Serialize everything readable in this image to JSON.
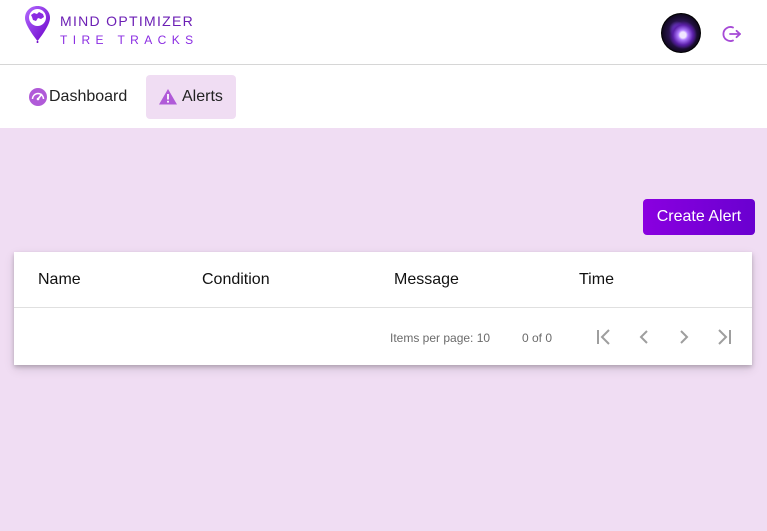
{
  "brand": {
    "line1": "MIND OPTIMIZER",
    "line2": "TIRE TRACKS",
    "color_primary": "#8a2be2"
  },
  "header": {
    "avatar_icon": "avatar-icon",
    "logout_icon": "logout-icon"
  },
  "nav": {
    "items": [
      {
        "label": "Dashboard",
        "icon": "speedometer-icon",
        "active": false
      },
      {
        "label": "Alerts",
        "icon": "warning-icon",
        "active": true
      }
    ]
  },
  "main": {
    "create_button_label": "Create Alert",
    "table": {
      "columns": [
        "Name",
        "Condition",
        "Message",
        "Time"
      ],
      "rows": []
    },
    "paginator": {
      "items_per_page_label": "Items per page:",
      "items_per_page_value": "10",
      "range_label": "0 of 0"
    }
  },
  "colors": {
    "background": "#f0ddf3",
    "accent": "#8a00e0"
  }
}
